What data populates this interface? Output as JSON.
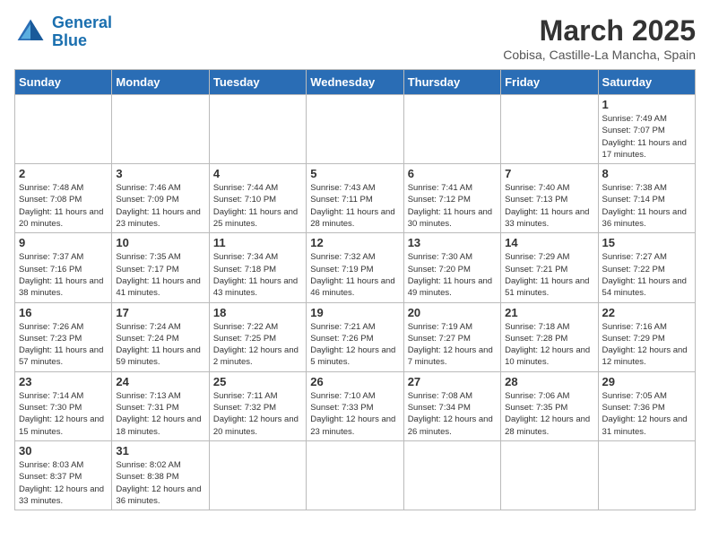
{
  "header": {
    "logo_general": "General",
    "logo_blue": "Blue",
    "month_year": "March 2025",
    "location": "Cobisa, Castille-La Mancha, Spain"
  },
  "weekdays": [
    "Sunday",
    "Monday",
    "Tuesday",
    "Wednesday",
    "Thursday",
    "Friday",
    "Saturday"
  ],
  "weeks": [
    [
      null,
      null,
      null,
      null,
      null,
      null,
      {
        "day": "1",
        "sunrise": "Sunrise: 7:49 AM",
        "sunset": "Sunset: 7:07 PM",
        "daylight": "Daylight: 11 hours and 17 minutes."
      }
    ],
    [
      {
        "day": "2",
        "sunrise": "Sunrise: 7:48 AM",
        "sunset": "Sunset: 7:08 PM",
        "daylight": "Daylight: 11 hours and 20 minutes."
      },
      {
        "day": "3",
        "sunrise": "Sunrise: 7:46 AM",
        "sunset": "Sunset: 7:09 PM",
        "daylight": "Daylight: 11 hours and 23 minutes."
      },
      {
        "day": "4",
        "sunrise": "Sunrise: 7:44 AM",
        "sunset": "Sunset: 7:10 PM",
        "daylight": "Daylight: 11 hours and 25 minutes."
      },
      {
        "day": "5",
        "sunrise": "Sunrise: 7:43 AM",
        "sunset": "Sunset: 7:11 PM",
        "daylight": "Daylight: 11 hours and 28 minutes."
      },
      {
        "day": "6",
        "sunrise": "Sunrise: 7:41 AM",
        "sunset": "Sunset: 7:12 PM",
        "daylight": "Daylight: 11 hours and 30 minutes."
      },
      {
        "day": "7",
        "sunrise": "Sunrise: 7:40 AM",
        "sunset": "Sunset: 7:13 PM",
        "daylight": "Daylight: 11 hours and 33 minutes."
      },
      {
        "day": "8",
        "sunrise": "Sunrise: 7:38 AM",
        "sunset": "Sunset: 7:14 PM",
        "daylight": "Daylight: 11 hours and 36 minutes."
      }
    ],
    [
      {
        "day": "9",
        "sunrise": "Sunrise: 7:37 AM",
        "sunset": "Sunset: 7:16 PM",
        "daylight": "Daylight: 11 hours and 38 minutes."
      },
      {
        "day": "10",
        "sunrise": "Sunrise: 7:35 AM",
        "sunset": "Sunset: 7:17 PM",
        "daylight": "Daylight: 11 hours and 41 minutes."
      },
      {
        "day": "11",
        "sunrise": "Sunrise: 7:34 AM",
        "sunset": "Sunset: 7:18 PM",
        "daylight": "Daylight: 11 hours and 43 minutes."
      },
      {
        "day": "12",
        "sunrise": "Sunrise: 7:32 AM",
        "sunset": "Sunset: 7:19 PM",
        "daylight": "Daylight: 11 hours and 46 minutes."
      },
      {
        "day": "13",
        "sunrise": "Sunrise: 7:30 AM",
        "sunset": "Sunset: 7:20 PM",
        "daylight": "Daylight: 11 hours and 49 minutes."
      },
      {
        "day": "14",
        "sunrise": "Sunrise: 7:29 AM",
        "sunset": "Sunset: 7:21 PM",
        "daylight": "Daylight: 11 hours and 51 minutes."
      },
      {
        "day": "15",
        "sunrise": "Sunrise: 7:27 AM",
        "sunset": "Sunset: 7:22 PM",
        "daylight": "Daylight: 11 hours and 54 minutes."
      }
    ],
    [
      {
        "day": "16",
        "sunrise": "Sunrise: 7:26 AM",
        "sunset": "Sunset: 7:23 PM",
        "daylight": "Daylight: 11 hours and 57 minutes."
      },
      {
        "day": "17",
        "sunrise": "Sunrise: 7:24 AM",
        "sunset": "Sunset: 7:24 PM",
        "daylight": "Daylight: 11 hours and 59 minutes."
      },
      {
        "day": "18",
        "sunrise": "Sunrise: 7:22 AM",
        "sunset": "Sunset: 7:25 PM",
        "daylight": "Daylight: 12 hours and 2 minutes."
      },
      {
        "day": "19",
        "sunrise": "Sunrise: 7:21 AM",
        "sunset": "Sunset: 7:26 PM",
        "daylight": "Daylight: 12 hours and 5 minutes."
      },
      {
        "day": "20",
        "sunrise": "Sunrise: 7:19 AM",
        "sunset": "Sunset: 7:27 PM",
        "daylight": "Daylight: 12 hours and 7 minutes."
      },
      {
        "day": "21",
        "sunrise": "Sunrise: 7:18 AM",
        "sunset": "Sunset: 7:28 PM",
        "daylight": "Daylight: 12 hours and 10 minutes."
      },
      {
        "day": "22",
        "sunrise": "Sunrise: 7:16 AM",
        "sunset": "Sunset: 7:29 PM",
        "daylight": "Daylight: 12 hours and 12 minutes."
      }
    ],
    [
      {
        "day": "23",
        "sunrise": "Sunrise: 7:14 AM",
        "sunset": "Sunset: 7:30 PM",
        "daylight": "Daylight: 12 hours and 15 minutes."
      },
      {
        "day": "24",
        "sunrise": "Sunrise: 7:13 AM",
        "sunset": "Sunset: 7:31 PM",
        "daylight": "Daylight: 12 hours and 18 minutes."
      },
      {
        "day": "25",
        "sunrise": "Sunrise: 7:11 AM",
        "sunset": "Sunset: 7:32 PM",
        "daylight": "Daylight: 12 hours and 20 minutes."
      },
      {
        "day": "26",
        "sunrise": "Sunrise: 7:10 AM",
        "sunset": "Sunset: 7:33 PM",
        "daylight": "Daylight: 12 hours and 23 minutes."
      },
      {
        "day": "27",
        "sunrise": "Sunrise: 7:08 AM",
        "sunset": "Sunset: 7:34 PM",
        "daylight": "Daylight: 12 hours and 26 minutes."
      },
      {
        "day": "28",
        "sunrise": "Sunrise: 7:06 AM",
        "sunset": "Sunset: 7:35 PM",
        "daylight": "Daylight: 12 hours and 28 minutes."
      },
      {
        "day": "29",
        "sunrise": "Sunrise: 7:05 AM",
        "sunset": "Sunset: 7:36 PM",
        "daylight": "Daylight: 12 hours and 31 minutes."
      }
    ],
    [
      {
        "day": "30",
        "sunrise": "Sunrise: 8:03 AM",
        "sunset": "Sunset: 8:37 PM",
        "daylight": "Daylight: 12 hours and 33 minutes."
      },
      {
        "day": "31",
        "sunrise": "Sunrise: 8:02 AM",
        "sunset": "Sunset: 8:38 PM",
        "daylight": "Daylight: 12 hours and 36 minutes."
      },
      null,
      null,
      null,
      null,
      null
    ]
  ]
}
